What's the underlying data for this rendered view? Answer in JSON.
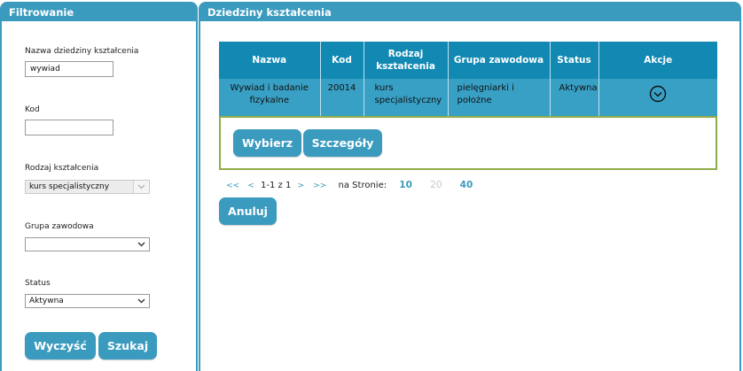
{
  "filter_panel": {
    "title": "Filtrowanie",
    "name_label": "Nazwa dziedziny kształcenia",
    "name_value": "wywiad",
    "code_label": "Kod",
    "code_value": "",
    "training_type_label": "Rodzaj kształcenia",
    "training_type_value": "kurs specjalistyczny",
    "professional_group_label": "Grupa zawodowa",
    "professional_group_value": "",
    "status_label": "Status",
    "status_value": "Aktywna",
    "clear_label": "Wyczyść",
    "search_label": "Szukaj"
  },
  "results_panel": {
    "title": "Dziedziny kształcenia",
    "columns": [
      "Nazwa",
      "Kod",
      "Rodzaj kształcenia",
      "Grupa zawodowa",
      "Status",
      "Akcje"
    ],
    "rows": [
      {
        "name": "Wywiad i badanie fizykalne",
        "code": "20014",
        "training_type": "kurs specjalistyczny",
        "professional_group": "pielęgniarki i położne",
        "status": "Aktywna",
        "action_icon": "chevron-down-circle-icon"
      }
    ],
    "select_label": "Wybierz",
    "details_label": "Szczegóły",
    "pager": {
      "first": "<<",
      "prev": "<",
      "range": "1-1 z 1",
      "next": ">",
      "last": ">>",
      "per_page_label": "na Stronie:",
      "page_sizes": [
        "10",
        "20",
        "40"
      ]
    },
    "cancel_label": "Anuluj"
  },
  "colors": {
    "accent": "#3a9bbf",
    "table_header": "#1289b3",
    "table_row": "#38a0c5",
    "action_border": "#8fac48"
  }
}
